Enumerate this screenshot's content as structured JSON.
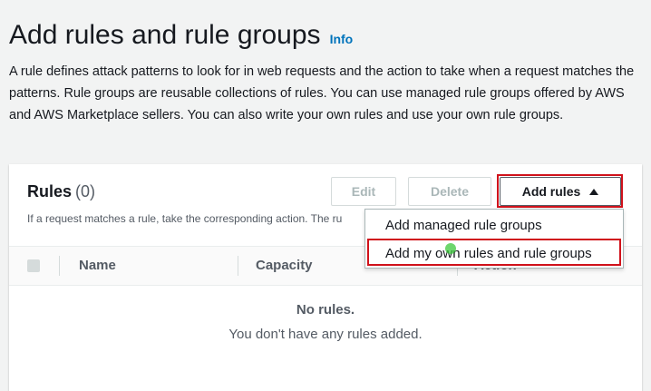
{
  "header": {
    "title": "Add rules and rule groups",
    "info_link": "Info",
    "description": "A rule defines attack patterns to look for in web requests and the action to take when a request matches the patterns. Rule groups are reusable collections of rules. You can use managed rule groups offered by AWS and AWS Marketplace sellers. You can also write your own rules and use your own rule groups."
  },
  "rules_panel": {
    "title": "Rules",
    "count": "(0)",
    "description": "If a request matches a rule, take the corresponding action. The ru",
    "buttons": {
      "edit": "Edit",
      "delete": "Delete",
      "add_rules": "Add rules"
    },
    "dropdown": {
      "items": [
        "Add managed rule groups",
        "Add my own rules and rule groups"
      ]
    },
    "table": {
      "columns": [
        "Name",
        "Capacity",
        "Action"
      ]
    },
    "empty_state": {
      "title": "No rules.",
      "description": "You don't have any rules added."
    }
  },
  "colors": {
    "link": "#0073bb",
    "highlight": "#d0121b",
    "background": "#f2f3f3"
  }
}
